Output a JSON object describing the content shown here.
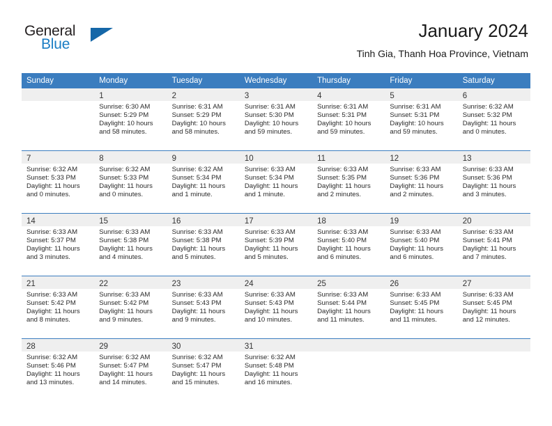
{
  "brand": {
    "name_part1": "General",
    "name_part2": "Blue",
    "accent_color": "#1a7dc4",
    "triangle_color": "#1567a8"
  },
  "header": {
    "title": "January 2024",
    "subtitle": "Tinh Gia, Thanh Hoa Province, Vietnam"
  },
  "calendar": {
    "header_bg": "#3b7dbf",
    "daynum_bg": "#efefef",
    "weekdays": [
      "Sunday",
      "Monday",
      "Tuesday",
      "Wednesday",
      "Thursday",
      "Friday",
      "Saturday"
    ],
    "weeks": [
      [
        {
          "day": "",
          "empty": true,
          "l1": "",
          "l2": "",
          "l3": "",
          "l4": ""
        },
        {
          "day": "1",
          "l1": "Sunrise: 6:30 AM",
          "l2": "Sunset: 5:29 PM",
          "l3": "Daylight: 10 hours",
          "l4": "and 58 minutes."
        },
        {
          "day": "2",
          "l1": "Sunrise: 6:31 AM",
          "l2": "Sunset: 5:29 PM",
          "l3": "Daylight: 10 hours",
          "l4": "and 58 minutes."
        },
        {
          "day": "3",
          "l1": "Sunrise: 6:31 AM",
          "l2": "Sunset: 5:30 PM",
          "l3": "Daylight: 10 hours",
          "l4": "and 59 minutes."
        },
        {
          "day": "4",
          "l1": "Sunrise: 6:31 AM",
          "l2": "Sunset: 5:31 PM",
          "l3": "Daylight: 10 hours",
          "l4": "and 59 minutes."
        },
        {
          "day": "5",
          "l1": "Sunrise: 6:31 AM",
          "l2": "Sunset: 5:31 PM",
          "l3": "Daylight: 10 hours",
          "l4": "and 59 minutes."
        },
        {
          "day": "6",
          "l1": "Sunrise: 6:32 AM",
          "l2": "Sunset: 5:32 PM",
          "l3": "Daylight: 11 hours",
          "l4": "and 0 minutes."
        }
      ],
      [
        {
          "day": "7",
          "l1": "Sunrise: 6:32 AM",
          "l2": "Sunset: 5:33 PM",
          "l3": "Daylight: 11 hours",
          "l4": "and 0 minutes."
        },
        {
          "day": "8",
          "l1": "Sunrise: 6:32 AM",
          "l2": "Sunset: 5:33 PM",
          "l3": "Daylight: 11 hours",
          "l4": "and 0 minutes."
        },
        {
          "day": "9",
          "l1": "Sunrise: 6:32 AM",
          "l2": "Sunset: 5:34 PM",
          "l3": "Daylight: 11 hours",
          "l4": "and 1 minute."
        },
        {
          "day": "10",
          "l1": "Sunrise: 6:33 AM",
          "l2": "Sunset: 5:34 PM",
          "l3": "Daylight: 11 hours",
          "l4": "and 1 minute."
        },
        {
          "day": "11",
          "l1": "Sunrise: 6:33 AM",
          "l2": "Sunset: 5:35 PM",
          "l3": "Daylight: 11 hours",
          "l4": "and 2 minutes."
        },
        {
          "day": "12",
          "l1": "Sunrise: 6:33 AM",
          "l2": "Sunset: 5:36 PM",
          "l3": "Daylight: 11 hours",
          "l4": "and 2 minutes."
        },
        {
          "day": "13",
          "l1": "Sunrise: 6:33 AM",
          "l2": "Sunset: 5:36 PM",
          "l3": "Daylight: 11 hours",
          "l4": "and 3 minutes."
        }
      ],
      [
        {
          "day": "14",
          "l1": "Sunrise: 6:33 AM",
          "l2": "Sunset: 5:37 PM",
          "l3": "Daylight: 11 hours",
          "l4": "and 3 minutes."
        },
        {
          "day": "15",
          "l1": "Sunrise: 6:33 AM",
          "l2": "Sunset: 5:38 PM",
          "l3": "Daylight: 11 hours",
          "l4": "and 4 minutes."
        },
        {
          "day": "16",
          "l1": "Sunrise: 6:33 AM",
          "l2": "Sunset: 5:38 PM",
          "l3": "Daylight: 11 hours",
          "l4": "and 5 minutes."
        },
        {
          "day": "17",
          "l1": "Sunrise: 6:33 AM",
          "l2": "Sunset: 5:39 PM",
          "l3": "Daylight: 11 hours",
          "l4": "and 5 minutes."
        },
        {
          "day": "18",
          "l1": "Sunrise: 6:33 AM",
          "l2": "Sunset: 5:40 PM",
          "l3": "Daylight: 11 hours",
          "l4": "and 6 minutes."
        },
        {
          "day": "19",
          "l1": "Sunrise: 6:33 AM",
          "l2": "Sunset: 5:40 PM",
          "l3": "Daylight: 11 hours",
          "l4": "and 6 minutes."
        },
        {
          "day": "20",
          "l1": "Sunrise: 6:33 AM",
          "l2": "Sunset: 5:41 PM",
          "l3": "Daylight: 11 hours",
          "l4": "and 7 minutes."
        }
      ],
      [
        {
          "day": "21",
          "l1": "Sunrise: 6:33 AM",
          "l2": "Sunset: 5:42 PM",
          "l3": "Daylight: 11 hours",
          "l4": "and 8 minutes."
        },
        {
          "day": "22",
          "l1": "Sunrise: 6:33 AM",
          "l2": "Sunset: 5:42 PM",
          "l3": "Daylight: 11 hours",
          "l4": "and 9 minutes."
        },
        {
          "day": "23",
          "l1": "Sunrise: 6:33 AM",
          "l2": "Sunset: 5:43 PM",
          "l3": "Daylight: 11 hours",
          "l4": "and 9 minutes."
        },
        {
          "day": "24",
          "l1": "Sunrise: 6:33 AM",
          "l2": "Sunset: 5:43 PM",
          "l3": "Daylight: 11 hours",
          "l4": "and 10 minutes."
        },
        {
          "day": "25",
          "l1": "Sunrise: 6:33 AM",
          "l2": "Sunset: 5:44 PM",
          "l3": "Daylight: 11 hours",
          "l4": "and 11 minutes."
        },
        {
          "day": "26",
          "l1": "Sunrise: 6:33 AM",
          "l2": "Sunset: 5:45 PM",
          "l3": "Daylight: 11 hours",
          "l4": "and 11 minutes."
        },
        {
          "day": "27",
          "l1": "Sunrise: 6:33 AM",
          "l2": "Sunset: 5:45 PM",
          "l3": "Daylight: 11 hours",
          "l4": "and 12 minutes."
        }
      ],
      [
        {
          "day": "28",
          "l1": "Sunrise: 6:32 AM",
          "l2": "Sunset: 5:46 PM",
          "l3": "Daylight: 11 hours",
          "l4": "and 13 minutes."
        },
        {
          "day": "29",
          "l1": "Sunrise: 6:32 AM",
          "l2": "Sunset: 5:47 PM",
          "l3": "Daylight: 11 hours",
          "l4": "and 14 minutes."
        },
        {
          "day": "30",
          "l1": "Sunrise: 6:32 AM",
          "l2": "Sunset: 5:47 PM",
          "l3": "Daylight: 11 hours",
          "l4": "and 15 minutes."
        },
        {
          "day": "31",
          "l1": "Sunrise: 6:32 AM",
          "l2": "Sunset: 5:48 PM",
          "l3": "Daylight: 11 hours",
          "l4": "and 16 minutes."
        },
        {
          "day": "",
          "empty": true,
          "l1": "",
          "l2": "",
          "l3": "",
          "l4": ""
        },
        {
          "day": "",
          "empty": true,
          "l1": "",
          "l2": "",
          "l3": "",
          "l4": ""
        },
        {
          "day": "",
          "empty": true,
          "l1": "",
          "l2": "",
          "l3": "",
          "l4": ""
        }
      ]
    ]
  }
}
